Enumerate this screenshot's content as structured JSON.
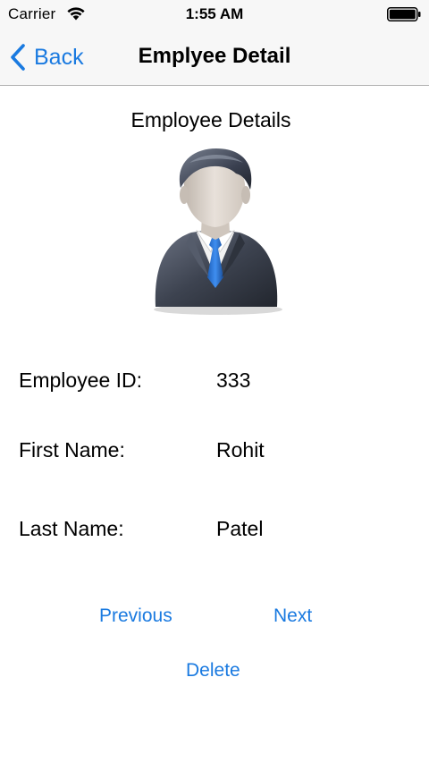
{
  "status_bar": {
    "carrier": "Carrier",
    "time": "1:55 AM",
    "wifi_icon": "wifi-icon",
    "battery_icon": "battery-icon"
  },
  "nav": {
    "back_label": "Back",
    "title": "Emplyee Detail",
    "accent_color": "#1a7ae0"
  },
  "content": {
    "section_title": "Employee Details",
    "avatar_icon": "businessman-avatar-icon",
    "fields": [
      {
        "label": "Employee ID:",
        "value": "333"
      },
      {
        "label": "First Name:",
        "value": "Rohit"
      },
      {
        "label": "Last Name:",
        "value": "Patel"
      }
    ]
  },
  "actions": {
    "previous_label": "Previous",
    "next_label": "Next",
    "delete_label": "Delete"
  }
}
